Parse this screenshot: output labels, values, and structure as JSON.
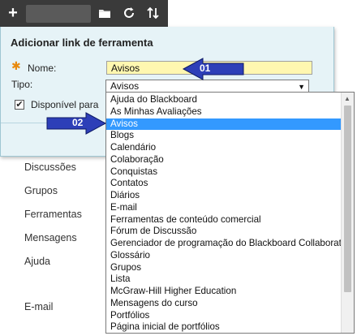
{
  "toolbar": {
    "add_label": "+",
    "icons": [
      "folder-icon",
      "refresh-icon",
      "sort-icon"
    ]
  },
  "sidebar": {
    "items": [
      {
        "label": "Discussões"
      },
      {
        "label": "Grupos"
      },
      {
        "label": "Ferramentas"
      },
      {
        "label": "Mensagens"
      },
      {
        "label": "Ajuda"
      },
      {
        "label": "E-mail"
      }
    ]
  },
  "dialog": {
    "title": "Adicionar link de ferramenta",
    "required_mark": "✱",
    "name_label": "Nome:",
    "name_value": "Avisos",
    "type_label": "Tipo:",
    "type_selected": "Avisos",
    "available_label": "Disponível para",
    "available_checked": true
  },
  "dropdown": {
    "selected_index": 2,
    "options": [
      "Ajuda do Blackboard",
      "As Minhas Avaliações",
      "Avisos",
      "Blogs",
      "Calendário",
      "Colaboração",
      "Conquistas",
      "Contatos",
      "Diários",
      "E-mail",
      "Ferramentas de conteúdo comercial",
      "Fórum de Discussão",
      "Gerenciador de programação do Blackboard Collaborate",
      "Glossário",
      "Grupos",
      "Lista",
      "McGraw-Hill Higher Education",
      "Mensagens do curso",
      "Portfólios",
      "Página inicial de portfólios"
    ]
  },
  "annotations": [
    {
      "label": "01",
      "color": "#2d3fb8"
    },
    {
      "label": "02",
      "color": "#2d3fb8"
    }
  ],
  "colors": {
    "toolbar_bg": "#3a3a3a",
    "panel_bg": "#e6f3f7",
    "input_highlight": "#fff7b0",
    "selection": "#3399ff",
    "required": "#e8890c",
    "arrow": "#2d3fb8"
  }
}
